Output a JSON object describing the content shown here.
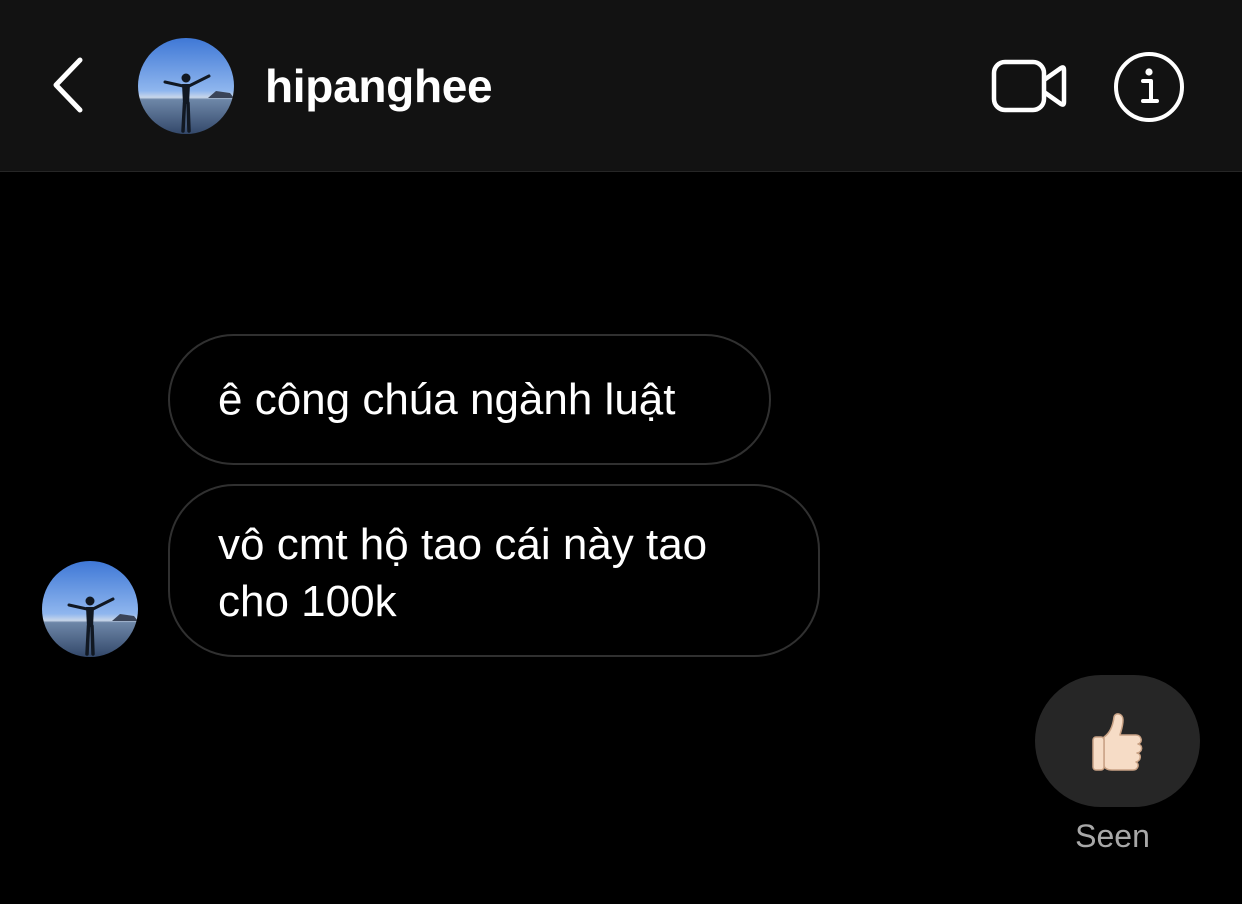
{
  "header": {
    "username": "hipanghee",
    "back_icon": "chevron-left-icon",
    "video_icon": "video-camera-icon",
    "info_icon": "info-circle-icon"
  },
  "messages": [
    {
      "sender": "hipanghee",
      "text": "ê công chúa ngành luật"
    },
    {
      "sender": "hipanghee",
      "text": "vô cmt hộ tao cái này tao cho 100k"
    }
  ],
  "reply": {
    "emoji": "👍🏻",
    "icon": "thumbs-up-icon",
    "status": "Seen"
  },
  "colors": {
    "header_bg": "#121212",
    "chat_bg": "#000000",
    "bubble_border": "#303030",
    "reaction_bg": "#262626",
    "status_text": "#a8a8a8"
  }
}
